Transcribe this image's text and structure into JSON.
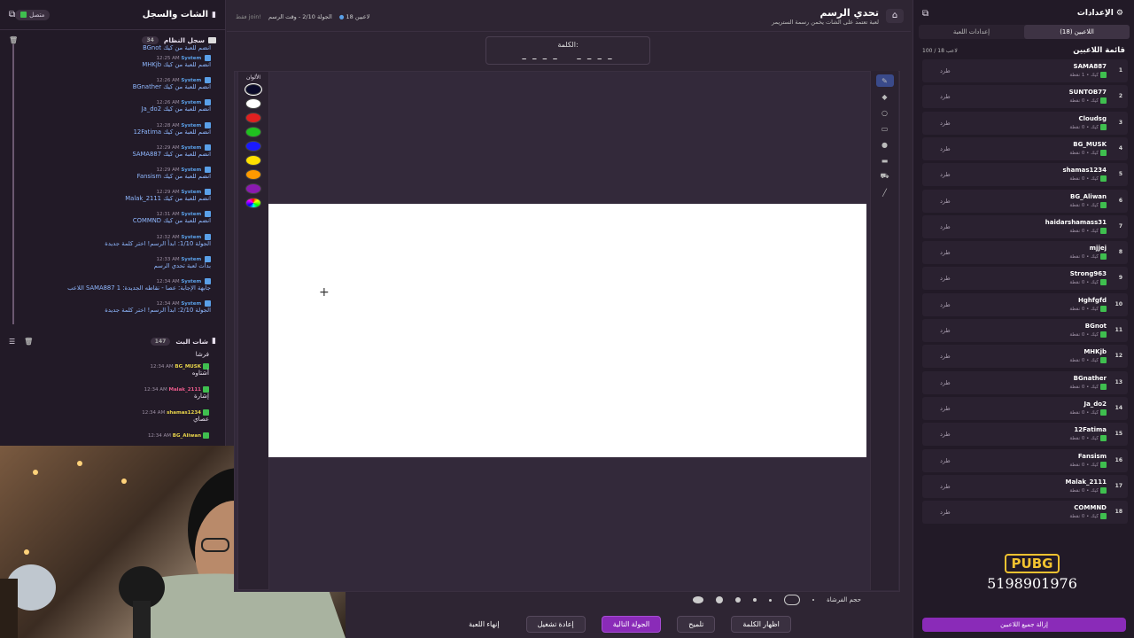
{
  "left": {
    "title": "الشات والسجل",
    "status": "متصل",
    "syslog_title": "سجل النظام",
    "syslog_count": "34",
    "syslog": [
      {
        "time": "",
        "text": "BGnot انضم للعبة من كيك"
      },
      {
        "time": "12:25 AM",
        "text": "MHKjb انضم للعبة من كيك"
      },
      {
        "time": "12:26 AM",
        "text": "BGnather انضم للعبة من كيك"
      },
      {
        "time": "12:26 AM",
        "text": "Ja_do2 انضم للعبة من كيك"
      },
      {
        "time": "12:28 AM",
        "text": "12Fatima انضم للعبة من كيك"
      },
      {
        "time": "12:29 AM",
        "text": "SAMA887 انضم للعبة من كيك"
      },
      {
        "time": "12:29 AM",
        "text": "Fansism انضم للعبة من كيك"
      },
      {
        "time": "12:29 AM",
        "text": "Malak_2111 انضم للعبة من كيك"
      },
      {
        "time": "12:31 AM",
        "text": "COMMND انضم للعبة من كيك"
      },
      {
        "time": "12:32 AM",
        "text": "الجولة 1/10: ابدأ الرسم! اختر كلمة جديدة"
      },
      {
        "time": "12:33 AM",
        "text": "بدأت لعبة تحدي الرسم"
      },
      {
        "time": "12:34 AM",
        "text": "اللاعب SAMA887 جابهة الإجابة: عصا - نقاطه الجديدة: 1"
      },
      {
        "time": "12:34 AM",
        "text": "الجولة 2/10: ابدأ الرسم! اختر كلمة جديدة"
      }
    ],
    "syslog_sender": "System",
    "chat_title": "شات البث",
    "chat_count": "147",
    "chat_first": "فرشا",
    "chat": [
      {
        "time": "12:34 AM",
        "user": "BG_MUSK",
        "color": "#e8d44a",
        "text": "أشتاوه"
      },
      {
        "time": "12:34 AM",
        "user": "Malak_2111",
        "color": "#e85a8a",
        "text": "إشارة"
      },
      {
        "time": "12:34 AM",
        "user": "shamas1234",
        "color": "#e8d44a",
        "text": "عصاي"
      },
      {
        "time": "12:34 AM",
        "user": "BG_Aliwan",
        "color": "#e8d44a",
        "text": ""
      }
    ]
  },
  "center": {
    "title": "تحدي الرسم",
    "subtitle": "لعبة تعتمد على الشات يخمن رسمة الستريمر",
    "players_badge": "18 لاعبين",
    "round_info": "الجولة 2/10 - وقت الرسم",
    "joined_badge": "فقط join!",
    "word_label": "الكلمة:",
    "word_mask": "_ _ _ _    _ _ _ _",
    "colors_label": "الألوان",
    "colors": [
      "#0a0a2a",
      "#ffffff",
      "#e02020",
      "#20c020",
      "#1a1aff",
      "#ffe000",
      "#ff9a00",
      "#8a1ab0",
      "#111111"
    ],
    "brush_size_label": "حجم الفرشاة",
    "buttons": {
      "show_word": "اظهار الكلمة",
      "hint": "تلميح",
      "next_round": "الجولة التالية",
      "restart": "إعادة تشغيل",
      "end_game": "إنهاء اللعبة"
    }
  },
  "right": {
    "title": "الإعدادات",
    "tab_settings": "إعدادات اللعبة",
    "tab_players": "اللاعبين (18)",
    "list_title": "قائمة اللاعبين",
    "capacity": "100 / 18 لاعب",
    "kick_label": "طرد",
    "players": [
      {
        "n": "1",
        "name": "SAMA887",
        "score": "كيك • 1 نقطة"
      },
      {
        "n": "2",
        "name": "SUNTOB77",
        "score": "كيك • 0 نقطة"
      },
      {
        "n": "3",
        "name": "Cloudsg",
        "score": "كيك • 0 نقطة"
      },
      {
        "n": "4",
        "name": "BG_MUSK",
        "score": "كيك • 0 نقطة"
      },
      {
        "n": "5",
        "name": "shamas1234",
        "score": "كيك • 0 نقطة"
      },
      {
        "n": "6",
        "name": "BG_Aliwan",
        "score": "كيك • 0 نقطة"
      },
      {
        "n": "7",
        "name": "haidarshamass31",
        "score": "كيك • 0 نقطة"
      },
      {
        "n": "8",
        "name": "mjjej",
        "score": "كيك • 0 نقطة"
      },
      {
        "n": "9",
        "name": "Strong963",
        "score": "كيك • 0 نقطة"
      },
      {
        "n": "10",
        "name": "Hghfgfd",
        "score": "كيك • 0 نقطة"
      },
      {
        "n": "11",
        "name": "BGnot",
        "score": "كيك • 0 نقطة"
      },
      {
        "n": "12",
        "name": "MHKjb",
        "score": "كيك • 0 نقطة"
      },
      {
        "n": "13",
        "name": "BGnather",
        "score": "كيك • 0 نقطة"
      },
      {
        "n": "14",
        "name": "Ja_do2",
        "score": "كيك • 0 نقطة"
      },
      {
        "n": "15",
        "name": "12Fatima",
        "score": "كيك • 0 نقطة"
      },
      {
        "n": "16",
        "name": "Fansism",
        "score": "كيك • 0 نقطة"
      },
      {
        "n": "17",
        "name": "Malak_2111",
        "score": "كيك • 0 نقطة"
      },
      {
        "n": "18",
        "name": "COMMND",
        "score": "كيك • 0 نقطة"
      }
    ],
    "clear_all": "إزالة جميع اللاعبين",
    "pubg_logo": "PUBG",
    "pubg_id": "5198901976"
  }
}
